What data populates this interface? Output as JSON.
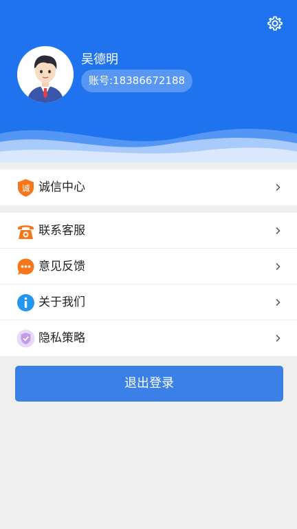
{
  "profile": {
    "name": "吴德明",
    "account": "账号:18386672188"
  },
  "menu_group_1": [
    {
      "label": "诚信中心",
      "icon": "integrity-badge-icon",
      "badge_char": "诚"
    }
  ],
  "menu_group_2": [
    {
      "label": "联系客服",
      "icon": "telephone-icon"
    },
    {
      "label": "意见反馈",
      "icon": "chat-bubble-icon"
    },
    {
      "label": "关于我们",
      "icon": "info-icon"
    },
    {
      "label": "隐私策略",
      "icon": "shield-check-icon"
    }
  ],
  "logout_label": "退出登录",
  "colors": {
    "header": "#1f73ef",
    "logout": "#3a80e6",
    "orange": "#f5761b",
    "info_blue": "#2196f3",
    "privacy_purple": "#c49be8"
  }
}
